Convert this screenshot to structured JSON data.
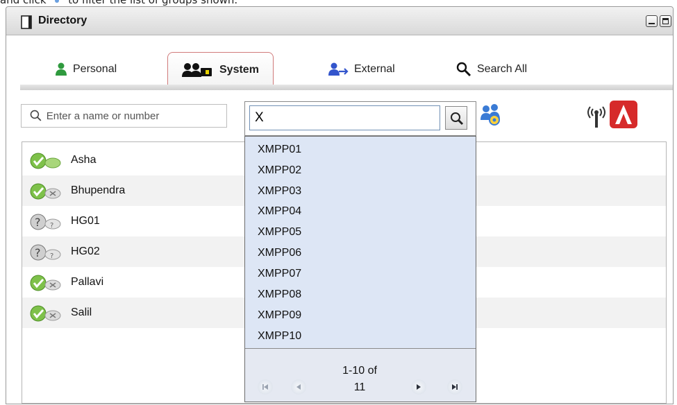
{
  "instruction": {
    "prefix": "and click",
    "suffix": "to filter the list of groups shown."
  },
  "window": {
    "title": "Directory"
  },
  "tabs": [
    {
      "label": "Personal",
      "icon": "person-green-icon"
    },
    {
      "label": "System",
      "icon": "system-people-icon",
      "active": true
    },
    {
      "label": "External",
      "icon": "person-arrow-icon"
    },
    {
      "label": "Search All",
      "icon": "magnifier-icon"
    }
  ],
  "search": {
    "placeholder": "Enter a name or number"
  },
  "group_filter": {
    "value": "X"
  },
  "contacts": [
    {
      "name": "Asha",
      "status": "available-chat"
    },
    {
      "name": "Bhupendra",
      "status": "available-offline-chat"
    },
    {
      "name": "HG01",
      "status": "unknown"
    },
    {
      "name": "HG02",
      "status": "unknown"
    },
    {
      "name": "Pallavi",
      "status": "available-offline-chat"
    },
    {
      "name": "Salil",
      "status": "available-offline-chat"
    }
  ],
  "dropdown": {
    "items": [
      "XMPP01",
      "XMPP02",
      "XMPP03",
      "XMPP04",
      "XMPP05",
      "XMPP06",
      "XMPP07",
      "XMPP08",
      "XMPP09",
      "XMPP10"
    ],
    "pagination_line1": "1-10 of",
    "pagination_line2": "11"
  },
  "colors": {
    "accent_red": "#d62a2a",
    "dropdown_bg": "#dde6f5",
    "tab_active_border": "#d07a7a"
  }
}
